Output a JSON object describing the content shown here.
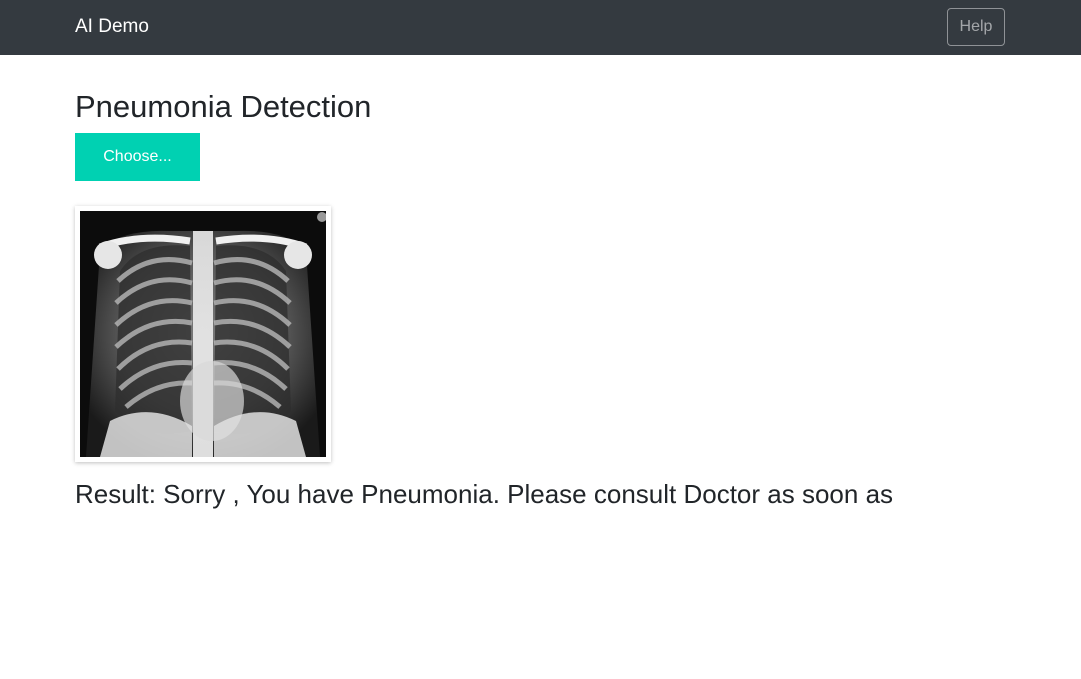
{
  "navbar": {
    "brand": "AI Demo",
    "help_label": "Help"
  },
  "main": {
    "title": "Pneumonia Detection",
    "choose_label": "Choose...",
    "result_text": "Result: Sorry , You have Pneumonia. Please consult Doctor as soon as"
  },
  "colors": {
    "navbar_bg": "#343a40",
    "accent": "#00d1b2"
  },
  "icons": {
    "preview": "chest-xray-image"
  }
}
